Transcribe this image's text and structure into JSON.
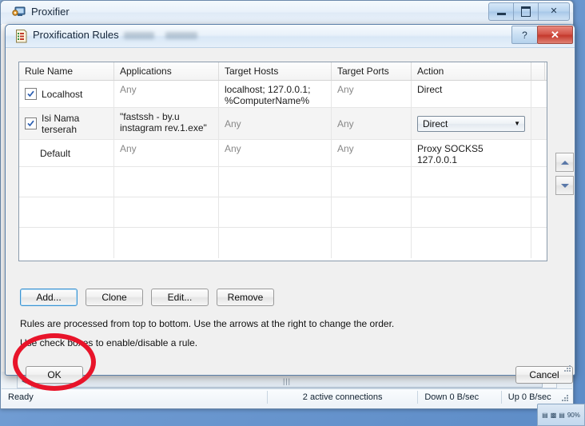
{
  "main_window": {
    "title": "Proxifier",
    "icon": "proxifier-app-icon",
    "controls": {
      "minimize": "minimize-icon",
      "maximize": "maximize-icon",
      "close": "✕"
    }
  },
  "dialog": {
    "title": "Proxification Rules",
    "icon": "rules-list-icon",
    "help_label": "?",
    "close_label": "✕",
    "grid": {
      "columns": [
        "Rule Name",
        "Applications",
        "Target Hosts",
        "Target Ports",
        "Action"
      ],
      "rows": [
        {
          "checkbox": true,
          "has_checkbox": true,
          "name": "Localhost",
          "applications": "Any",
          "applications_dim": true,
          "target_hosts": "localhost; 127.0.0.1; %ComputerName%",
          "target_hosts_dim": false,
          "target_ports": "Any",
          "target_ports_dim": true,
          "action": "Direct",
          "action_is_combo": false,
          "selected": false
        },
        {
          "checkbox": true,
          "has_checkbox": true,
          "name": "Isi Nama terserah",
          "applications": "\"fastssh - by.u instagram rev.1.exe\"",
          "applications_dim": false,
          "target_hosts": "Any",
          "target_hosts_dim": true,
          "target_ports": "Any",
          "target_ports_dim": true,
          "action": "Direct",
          "action_is_combo": true,
          "selected": true
        },
        {
          "checkbox": false,
          "has_checkbox": false,
          "name": "Default",
          "applications": "Any",
          "applications_dim": true,
          "target_hosts": "Any",
          "target_hosts_dim": true,
          "target_ports": "Any",
          "target_ports_dim": true,
          "action": "Proxy SOCKS5 127.0.0.1",
          "action_is_combo": false,
          "selected": false
        }
      ],
      "empty_row_count": 3
    },
    "order_buttons": {
      "move_up": "up-arrow-icon",
      "move_down": "down-arrow-icon"
    },
    "toolbar": {
      "add_label": "Add...",
      "clone_label": "Clone",
      "edit_label": "Edit...",
      "remove_label": "Remove"
    },
    "notes": {
      "line1": "Rules are processed from top to bottom. Use the arrows at the right to change the order.",
      "line2": "Use check boxes to enable/disable a rule."
    },
    "footer": {
      "ok_label": "OK",
      "cancel_label": "Cancel"
    }
  },
  "annotation": {
    "shape": "red-ellipse-highlight",
    "target": "OK",
    "color": "#e8142a"
  },
  "status_bar": {
    "state": "Ready",
    "connections": "2 active connections",
    "download": "Down 0 B/sec",
    "upload": "Up 0 B/sec"
  },
  "scrollbar": {
    "left_arrow": "◀",
    "right_arrow": "▶",
    "grip": "|||"
  }
}
